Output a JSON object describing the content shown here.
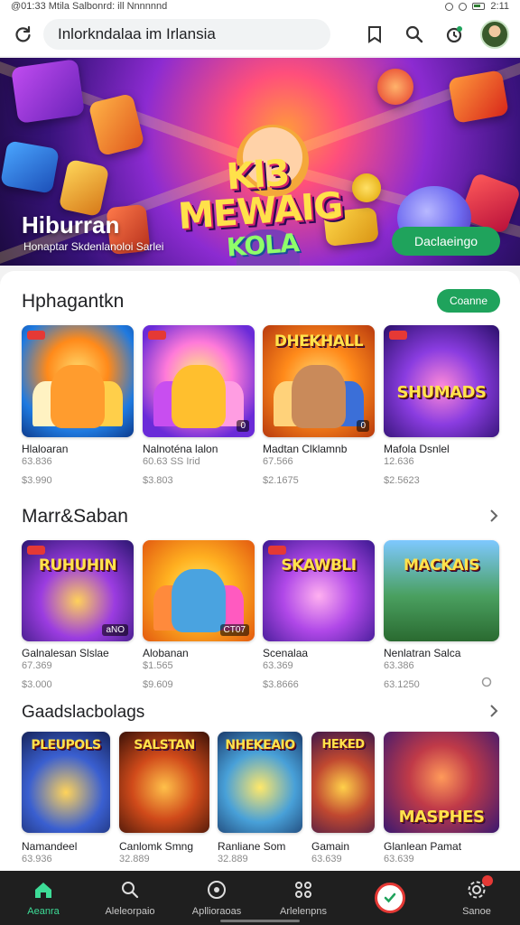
{
  "status_bar": {
    "left_text": "@01:33 Mtila Salbonrd: ill Nnnnnnd",
    "time": "2:11"
  },
  "top_bar": {
    "search_value": "Inlorkndalaa im Irlansia",
    "icons": [
      "refresh-icon",
      "bookmark-icon",
      "search-icon",
      "notification-icon",
      "avatar"
    ]
  },
  "hero": {
    "logo_line1": "Kl3 MEWAIG",
    "logo_line2": "KOLA",
    "title": "Hiburran",
    "subtitle": "Honaptar Skdenlanoloi Sarlei",
    "button": "Daclaeingo"
  },
  "sections": [
    {
      "title": "Hphagantkn",
      "more_button": "Coanne",
      "apps": [
        {
          "art_title": "",
          "corner": "",
          "name": "Hlaloaran",
          "meta": "63.836",
          "price": "$3.990"
        },
        {
          "art_title": "",
          "corner": "0",
          "name": "Nalnoténa lalon",
          "meta": "60.63 SS Irid",
          "price": "$3.803"
        },
        {
          "art_title": "DHEKHALL",
          "corner": "0",
          "name": "Madtan Clklamnb",
          "meta": "67.566",
          "price": "$2.1675"
        },
        {
          "art_title": "SHUMADS",
          "corner": "",
          "name": "Mafola Dsnlel",
          "meta": "12.636",
          "price": "$2.5623"
        }
      ]
    },
    {
      "title": "Marr&Saban",
      "apps": [
        {
          "art_title": "RUHUHIN",
          "corner": "aNO",
          "name": "Galnalesan Slslae",
          "meta": "67.369",
          "price": "$3.000"
        },
        {
          "art_title": "",
          "corner": "CT07",
          "name": "Alobanan",
          "meta": "$1.565",
          "price": "$9.609"
        },
        {
          "art_title": "SKAWBLI",
          "corner": "",
          "name": "Scenalaa",
          "meta": "63.369",
          "price": "$3.8666"
        },
        {
          "art_title": "MACKAIS",
          "corner": "",
          "name": "Nenlatran Salca",
          "meta": "63.386",
          "price": "63.1250"
        }
      ]
    },
    {
      "title": "Gaadslacbolags",
      "apps": [
        {
          "art_title": "PLEUPOLS",
          "corner": "",
          "name": "Namandeel",
          "meta": "63.936",
          "price": ""
        },
        {
          "art_title": "SALSTAN",
          "corner": "",
          "name": "Canlomk Smng",
          "meta": "32.889",
          "price": ""
        },
        {
          "art_title": "NHEKEAIO",
          "corner": "",
          "name": "Ranliane Som",
          "meta": "32.889",
          "price": ""
        },
        {
          "art_title": "HEKED",
          "corner": "",
          "name": "Gamain",
          "meta": "63.639",
          "price": ""
        },
        {
          "art_title": "MASPHES",
          "corner": "",
          "name": "Glanlean Pamat",
          "meta": "63.639",
          "price": ""
        }
      ]
    }
  ],
  "bottom_nav": [
    {
      "label": "Aeanra",
      "icon": "home-icon",
      "active": true
    },
    {
      "label": "Aleleorpaio",
      "icon": "search-icon"
    },
    {
      "label": "Apllioraoas",
      "icon": "compass-icon"
    },
    {
      "label": "Arlelenpns",
      "icon": "apps-icon"
    },
    {
      "label": "",
      "icon": "center-action-icon"
    },
    {
      "label": "Sanoe",
      "icon": "settings-icon"
    }
  ],
  "colors": {
    "accent": "#1fa35c",
    "nav_bg": "#1f1f1f",
    "nav_active": "#3ddc97",
    "badge": "#e53935"
  }
}
